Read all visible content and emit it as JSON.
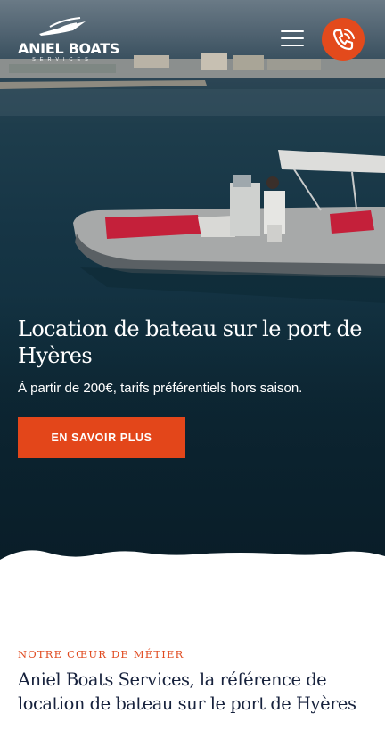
{
  "header": {
    "logo_name": "ANIEL BOATS",
    "logo_sub": "SERVICES",
    "menu_icon": "hamburger-menu-icon",
    "phone_icon": "phone-icon"
  },
  "hero": {
    "title": "Location de bateau sur le port de Hyères",
    "subtitle": "À partir de 200€, tarifs préférentiels hors saison.",
    "cta_label": "EN SAVOIR PLUS"
  },
  "section": {
    "kicker": "NOTRE CŒUR DE MÉTIER",
    "title": "Aniel Boats Services, la référence de location de bateau sur le port de Hyères"
  },
  "colors": {
    "accent": "#e3461a",
    "title_dark": "#17223d",
    "sea_dark": "#11303f"
  }
}
